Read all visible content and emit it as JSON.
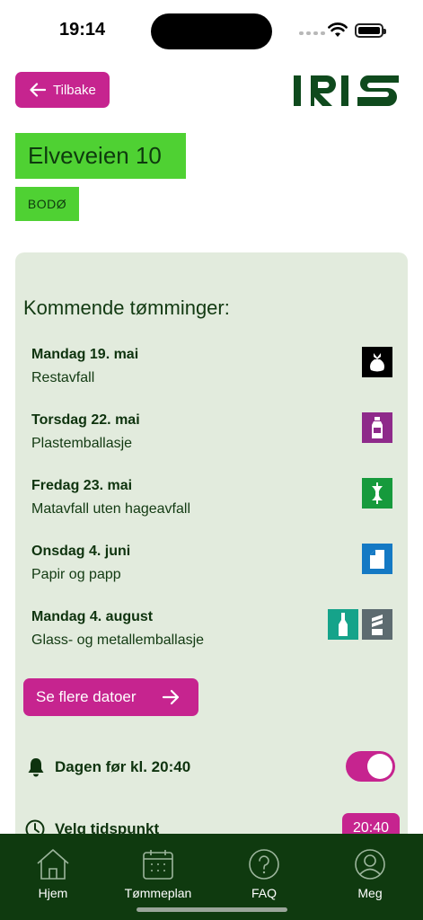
{
  "status_bar": {
    "time": "19:14"
  },
  "header": {
    "back_label": "Tilbake",
    "logo_text": "IRIS"
  },
  "address": {
    "street": "Elveveien 10",
    "city": "BODØ"
  },
  "schedule": {
    "title": "Kommende tømminger:",
    "pickups": [
      {
        "date": "Mandag 19. mai",
        "type": "Restavfall",
        "icons": [
          {
            "name": "residual-waste-icon",
            "color": "#000000"
          }
        ]
      },
      {
        "date": "Torsdag 22. mai",
        "type": "Plastemballasje",
        "icons": [
          {
            "name": "plastic-bottle-icon",
            "color": "#8e2a8a"
          }
        ]
      },
      {
        "date": "Fredag 23. mai",
        "type": "Matavfall uten hageavfall",
        "icons": [
          {
            "name": "apple-core-icon",
            "color": "#169a3c"
          }
        ]
      },
      {
        "date": "Onsdag 4. juni",
        "type": "Papir og papp",
        "icons": [
          {
            "name": "paper-icon",
            "color": "#1479c4"
          }
        ]
      },
      {
        "date": "Mandag 4. august",
        "type": "Glass- og metallemballasje",
        "icons": [
          {
            "name": "glass-bottle-icon",
            "color": "#15a38a"
          },
          {
            "name": "metal-can-icon",
            "color": "#5d6b70"
          }
        ]
      }
    ],
    "more_label": "Se flere datoer"
  },
  "notification": {
    "label": "Dagen før kl. 20:40",
    "enabled": true
  },
  "time_picker": {
    "label": "Velg tidspunkt",
    "value": "20:40"
  },
  "tabbar": {
    "tabs": [
      {
        "label": "Hjem",
        "icon": "home-icon"
      },
      {
        "label": "Tømmeplan",
        "icon": "calendar-icon"
      },
      {
        "label": "FAQ",
        "icon": "question-icon"
      },
      {
        "label": "Meg",
        "icon": "user-icon"
      }
    ]
  },
  "colors": {
    "accent": "#c6248f",
    "brand_green": "#4fd133",
    "dark_green": "#0f3a0f",
    "card_bg": "#e2ebdd"
  }
}
